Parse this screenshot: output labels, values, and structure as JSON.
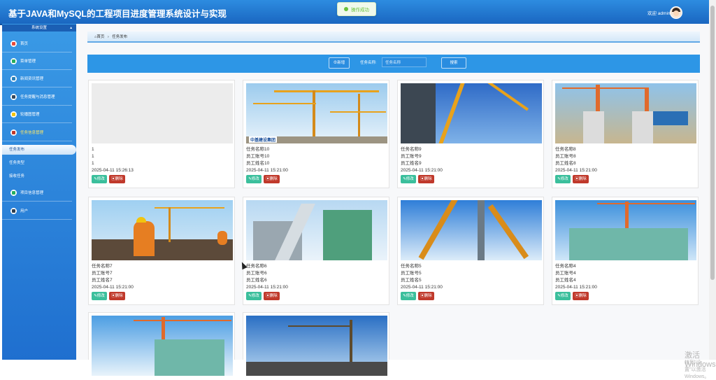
{
  "header": {
    "title": "基于JAVA和MySQL的工程项目进度管理系统设计与实现",
    "welcome": "欢迎 admin"
  },
  "toast": {
    "text": "操作成功"
  },
  "sidebar": {
    "section": "系统设置",
    "section_arrow": "▴",
    "items": [
      {
        "label": "首页",
        "icon": "home-icon",
        "color": "#e74c3c"
      },
      {
        "label": "菜单管理",
        "icon": "menu-icon",
        "color": "#27ae60"
      },
      {
        "label": "新闻资讯管理",
        "icon": "news-icon",
        "color": "#2980b9"
      },
      {
        "label": "任务提醒与消息管理",
        "icon": "task-reminder-icon",
        "color": "#34495e"
      },
      {
        "label": "轮播图管理",
        "icon": "carousel-icon",
        "color": "#f1c40f"
      },
      {
        "label": "任务信息管理",
        "icon": "task-info-icon",
        "color": "#c0392b"
      }
    ],
    "sub_items": [
      "任务发布",
      "任务类型",
      "接收任务"
    ],
    "more_items": [
      {
        "label": "项目信息管理",
        "icon": "project-icon",
        "color": "#27ae60"
      },
      {
        "label": "用户",
        "icon": "user-icon",
        "color": "#2c3e50"
      }
    ]
  },
  "breadcrumb": {
    "home": "⌂首页",
    "sep": "›",
    "current": "任务发布"
  },
  "toolbar": {
    "add_label": "⊕新增",
    "search_label": "任务名称:",
    "search_placeholder": "任务名称",
    "search_button": "搜索"
  },
  "cards": [
    {
      "name": "1",
      "account": "1",
      "employee": "1",
      "time": "2025-04-11 15:26:13"
    },
    {
      "name": "任务名称10",
      "account": "员工账号10",
      "employee": "员工姓名10",
      "time": "2025-04-11 15:21:00"
    },
    {
      "name": "任务名称9",
      "account": "员工账号9",
      "employee": "员工姓名9",
      "time": "2025-04-11 15:21:00"
    },
    {
      "name": "任务名称8",
      "account": "员工账号8",
      "employee": "员工姓名8",
      "time": "2025-04-11 15:21:00"
    },
    {
      "name": "任务名称7",
      "account": "员工账号7",
      "employee": "员工姓名7",
      "time": "2025-04-11 15:21:00"
    },
    {
      "name": "任务名称6",
      "account": "员工账号6",
      "employee": "员工姓名6",
      "time": "2025-04-11 15:21:00"
    },
    {
      "name": "任务名称5",
      "account": "员工账号5",
      "employee": "员工姓名5",
      "time": "2025-04-11 15:21:00"
    },
    {
      "name": "任务名称4",
      "account": "员工账号4",
      "employee": "员工姓名4",
      "time": "2025-04-11 15:21:00"
    }
  ],
  "card_buttons": {
    "edit": "✎修改",
    "delete": "▣删除"
  },
  "card2_logo": "中基建设集团",
  "watermark": {
    "line1": "激活 Windows",
    "line2": "转到\"设置\"以激活 Windows。"
  }
}
